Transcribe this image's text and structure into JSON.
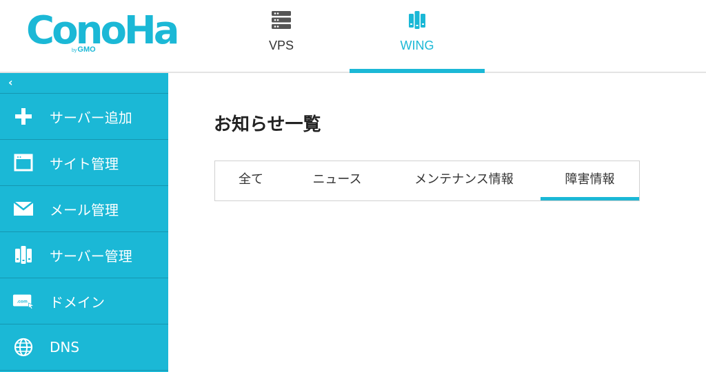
{
  "header": {
    "logo_text": "ConoHa",
    "logo_by": "by",
    "logo_sub": "GMO",
    "tabs": [
      {
        "label": "VPS",
        "icon": "server-rack-icon",
        "active": false
      },
      {
        "label": "WING",
        "icon": "server-wing-icon",
        "active": true
      }
    ]
  },
  "sidebar": {
    "collapse_glyph": "‹",
    "items": [
      {
        "label": "サーバー追加",
        "icon": "plus-icon"
      },
      {
        "label": "サイト管理",
        "icon": "browser-window-icon"
      },
      {
        "label": "メール管理",
        "icon": "envelope-icon"
      },
      {
        "label": "サーバー管理",
        "icon": "server-icon"
      },
      {
        "label": "ドメイン",
        "icon": "domain-com-icon"
      },
      {
        "label": "DNS",
        "icon": "globe-icon"
      }
    ]
  },
  "main": {
    "title": "お知らせ一覧",
    "tabs": [
      {
        "label": "全て",
        "active": false
      },
      {
        "label": "ニュース",
        "active": false
      },
      {
        "label": "メンテナンス情報",
        "active": false
      },
      {
        "label": "障害情報",
        "active": true
      }
    ]
  },
  "colors": {
    "accent": "#1bb8d6",
    "sidebar_divider": "#1596b0",
    "text": "#222222"
  }
}
